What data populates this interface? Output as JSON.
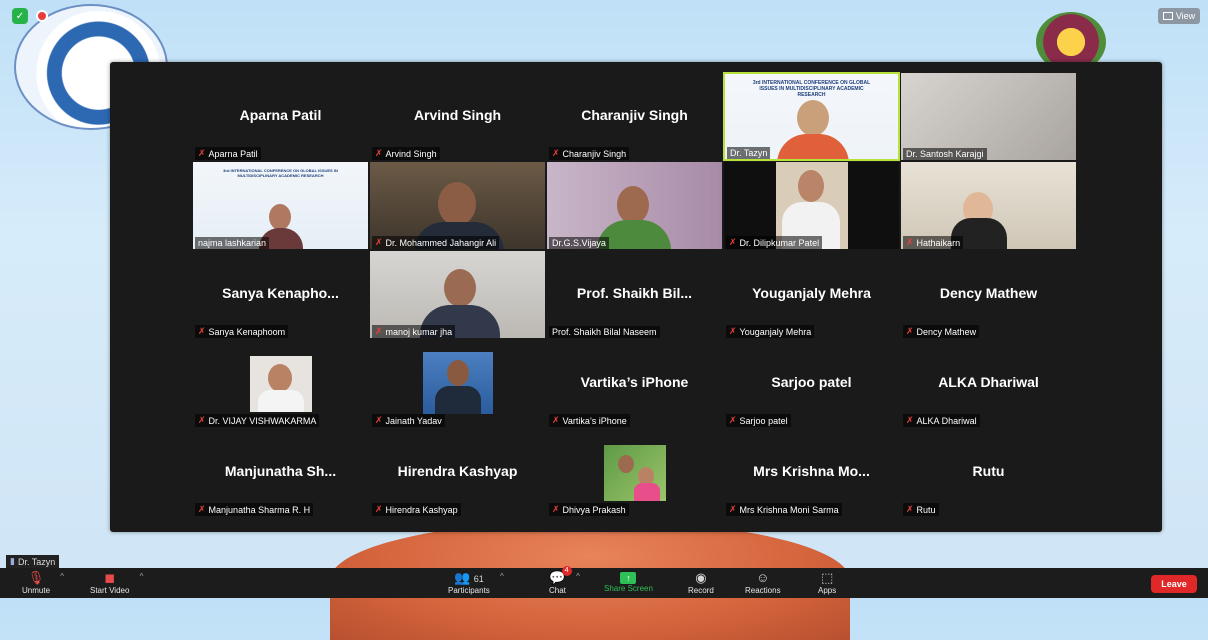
{
  "top": {
    "view_label": "View"
  },
  "tiles": [
    {
      "name": "Aparna Patil",
      "label": "Aparna Patil",
      "muted": true
    },
    {
      "name": "Arvind Singh",
      "label": "Arvind Singh",
      "muted": true
    },
    {
      "name": "Charanjiv Singh",
      "label": "Charanjiv Singh",
      "muted": true
    },
    {
      "name": "",
      "label": "Dr. Tazyn",
      "muted": false,
      "video": "speaker"
    },
    {
      "name": "",
      "label": "Dr. Santosh Karajgi",
      "muted": false,
      "video": "wall"
    },
    {
      "name": "",
      "label": "najma lashkarian",
      "muted": false,
      "video": "slide-woman"
    },
    {
      "name": "",
      "label": "Dr. Mohammed Jahangir Ali",
      "muted": true,
      "video": "man-office"
    },
    {
      "name": "",
      "label": "Dr.G.S.Vijaya",
      "muted": false,
      "video": "woman-purple"
    },
    {
      "name": "",
      "label": "Dr. Dilipkumar Patel",
      "muted": true,
      "video": "man-white"
    },
    {
      "name": "",
      "label": "Hathaikarn",
      "muted": true,
      "video": "woman-room"
    },
    {
      "name": "Sanya Kenapho...",
      "label": "Sanya Kenaphoom",
      "muted": true
    },
    {
      "name": "",
      "label": "manoj kumar jha",
      "muted": true,
      "video": "man-suit"
    },
    {
      "name": "Prof. Shaikh Bil...",
      "label": "Prof. Shaikh Bilal Naseem",
      "muted": false
    },
    {
      "name": "Youganjaly Mehra",
      "label": "Youganjaly Mehra",
      "muted": true
    },
    {
      "name": "Dency Mathew",
      "label": "Dency Mathew",
      "muted": true
    },
    {
      "name": "",
      "label": "Dr. VIJAY VISHWAKARMA",
      "muted": true,
      "video": "photo-man1"
    },
    {
      "name": "",
      "label": "Jainath Yadav",
      "muted": true,
      "video": "photo-man2"
    },
    {
      "name": "Vartika’s iPhone",
      "label": "Vartika’s iPhone",
      "muted": true
    },
    {
      "name": "Sarjoo patel",
      "label": "Sarjoo patel",
      "muted": true
    },
    {
      "name": "ALKA Dhariwal",
      "label": "ALKA Dhariwal",
      "muted": true
    },
    {
      "name": "Manjunatha Sh...",
      "label": "Manjunatha Sharma R. H",
      "muted": true
    },
    {
      "name": "Hirendra Kashyap",
      "label": "Hirendra Kashyap",
      "muted": true
    },
    {
      "name": "",
      "label": "Dhivya Prakash",
      "muted": true,
      "video": "photo-family"
    },
    {
      "name": "Mrs Krishna Mo...",
      "label": "Mrs Krishna Moni Sarma",
      "muted": true
    },
    {
      "name": "Rutu",
      "label": "Rutu",
      "muted": true
    }
  ],
  "slide_text": "3rd INTERNATIONAL CONFERENCE ON GLOBAL ISSUES IN MULTIDISCIPLINARY ACADEMIC RESEARCH",
  "speaking_label": "Dr. Tazyn",
  "toolbar": {
    "unmute": "Unmute",
    "start_video": "Start Video",
    "participants": "Participants",
    "participants_count": "61",
    "chat": "Chat",
    "chat_badge": "4",
    "share_screen": "Share Screen",
    "record": "Record",
    "reactions": "Reactions",
    "apps": "Apps",
    "leave": "Leave"
  },
  "colors": {
    "active_speaker": "#b6e23a",
    "share": "#2fbf57",
    "leave": "#e02828"
  }
}
